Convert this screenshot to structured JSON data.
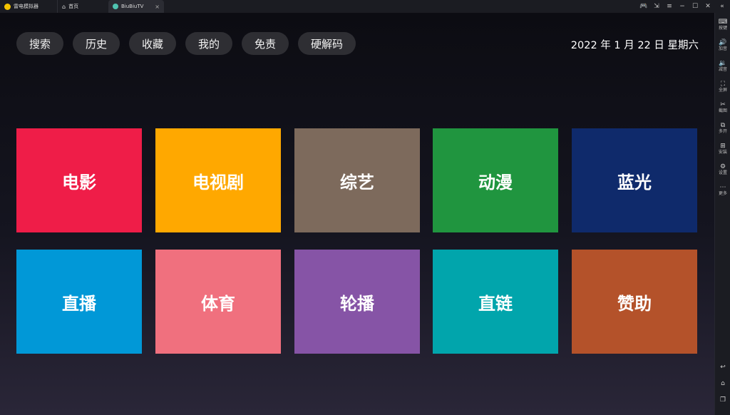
{
  "titlebar": {
    "tabs": [
      {
        "label": "雷电模拟器",
        "icon": "emulator-logo-icon"
      },
      {
        "label": "首页",
        "icon": "home-icon"
      },
      {
        "label": "BiuBiuTV",
        "icon": "app-icon",
        "close": "×"
      }
    ],
    "controls": {
      "gamepad": "🎮",
      "pin": "⇲",
      "menu": "≡",
      "minimize": "−",
      "maximize": "☐",
      "close": "✕",
      "collapse": "«"
    }
  },
  "sidebar": {
    "items": [
      {
        "label": "按键",
        "icon": "⌨"
      },
      {
        "label": "加音",
        "icon": "🔊"
      },
      {
        "label": "减音",
        "icon": "🔉"
      },
      {
        "label": "全屏",
        "icon": "⛶"
      },
      {
        "label": "截图",
        "icon": "✂"
      },
      {
        "label": "多开",
        "icon": "⧉"
      },
      {
        "label": "安装",
        "icon": "⊞"
      },
      {
        "label": "设置",
        "icon": "⚙"
      },
      {
        "label": "更多",
        "icon": "⋯"
      }
    ],
    "bottom": {
      "back": "↩",
      "home": "⌂",
      "recent": "❐"
    }
  },
  "nav": {
    "buttons": [
      "搜索",
      "历史",
      "收藏",
      "我的",
      "免责",
      "硬解码"
    ]
  },
  "date": "2022 年 1 月 22 日 星期六",
  "tiles": [
    {
      "label": "电影",
      "color": "#ef1d48"
    },
    {
      "label": "电视剧",
      "color": "#ffa800"
    },
    {
      "label": "综艺",
      "color": "#7d6a5c"
    },
    {
      "label": "动漫",
      "color": "#20953f"
    },
    {
      "label": "蓝光",
      "color": "#0f2a6b"
    },
    {
      "label": "直播",
      "color": "#0198d7"
    },
    {
      "label": "体育",
      "color": "#f0707e"
    },
    {
      "label": "轮播",
      "color": "#8654a6"
    },
    {
      "label": "直链",
      "color": "#01a5ac"
    },
    {
      "label": "赞助",
      "color": "#b4522a"
    }
  ]
}
